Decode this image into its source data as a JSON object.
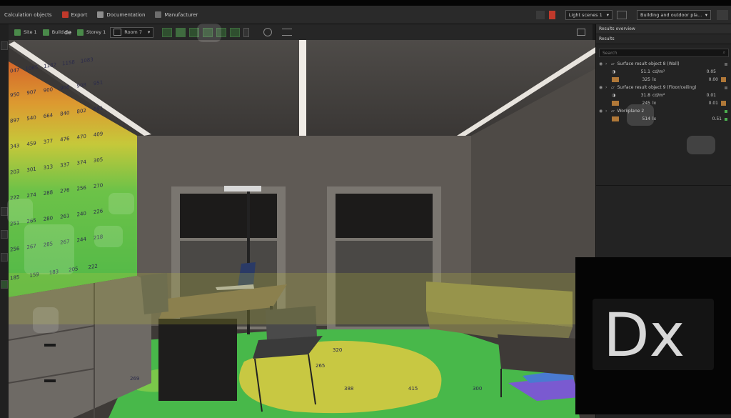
{
  "menubar": {
    "items": [
      {
        "label": "Calculation objects",
        "icon": "calculation-icon"
      },
      {
        "label": "Export",
        "icon": "export-icon"
      },
      {
        "label": "Documentation",
        "icon": "documentation-icon"
      },
      {
        "label": "Manufacturer",
        "icon": "manufacturer-icon"
      }
    ],
    "light_scenes_label": "Light scenes 1",
    "building_dropdown": "Building and outdoor pla..."
  },
  "toolbar": {
    "site_label": "Site 1",
    "building_label": "Build",
    "overlay_text": "de",
    "storey_label": "Storey 1",
    "room_dropdown": "Room 7"
  },
  "results_panel": {
    "title": "Results overview",
    "section": "Results",
    "search_placeholder": "Search",
    "rows": [
      {
        "type": "object",
        "label": "Surface result object 8 (Wall)"
      },
      {
        "type": "value",
        "icon": "luminance-icon",
        "value": "51.1",
        "unit": "cd/m²",
        "ratio": "0.05"
      },
      {
        "type": "value",
        "icon": "illuminance-icon",
        "value": "325",
        "unit": "lx",
        "ratio": "0.00"
      },
      {
        "type": "object",
        "label": "Surface result object 9 (Floor/ceiling)"
      },
      {
        "type": "value",
        "icon": "luminance-icon",
        "value": "31.8",
        "unit": "cd/m²",
        "ratio": "0.01"
      },
      {
        "type": "value",
        "icon": "illuminance-icon",
        "value": "245",
        "unit": "lx",
        "ratio": "0.01"
      },
      {
        "type": "object",
        "label": "Workplane 2"
      },
      {
        "type": "value",
        "icon": "illuminance-icon",
        "value": "514",
        "unit": "lx",
        "ratio": "0.51"
      }
    ]
  },
  "wall_values": [
    [
      "047",
      "1065",
      "1182",
      "1158",
      "1083"
    ],
    [
      "950",
      "907",
      "900",
      "906",
      "908",
      "951"
    ],
    [
      "897",
      "540",
      "664",
      "840",
      "802",
      "691"
    ],
    [
      "343",
      "459",
      "377",
      "476",
      "470",
      "409"
    ],
    [
      "203",
      "301",
      "313",
      "337",
      "374",
      "305"
    ],
    [
      "222",
      "274",
      "288",
      "276",
      "256",
      "270"
    ],
    [
      "251",
      "265",
      "280",
      "261",
      "240",
      "226"
    ],
    [
      "256",
      "267",
      "285",
      "267",
      "244",
      "218"
    ],
    [
      "185",
      "159",
      "183",
      "205",
      "222"
    ]
  ],
  "floor_values": [
    "269",
    "265",
    "388",
    "415",
    "320",
    "300"
  ],
  "logo_text": "Dx"
}
